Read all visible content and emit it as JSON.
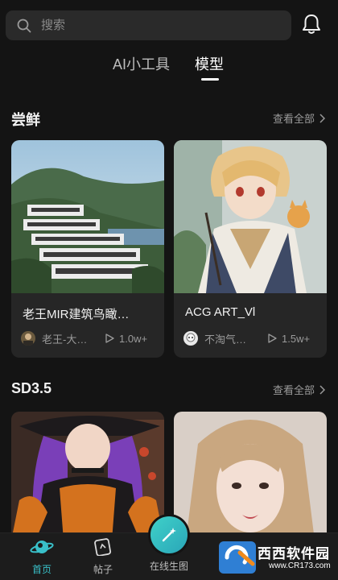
{
  "search": {
    "placeholder": "搜索"
  },
  "tabs": [
    {
      "label": "AI小工具"
    },
    {
      "label": "模型",
      "active": true
    }
  ],
  "sections": [
    {
      "title": "尝鲜",
      "more_label": "查看全部",
      "cards": [
        {
          "title": "老王MIR建筑鸟瞰…",
          "author": "老王-大…",
          "plays": "1.0w+"
        },
        {
          "title": "ACG ART_Vl",
          "author": "不淘气…",
          "plays": "1.5w+"
        }
      ]
    },
    {
      "title": "SD3.5",
      "more_label": "查看全部",
      "cards": []
    }
  ],
  "bottom_nav": [
    {
      "label": "首页",
      "icon": "planet-icon",
      "active": true
    },
    {
      "label": "帖子",
      "icon": "cards-icon"
    },
    {
      "label": "在线生图",
      "icon": "magic-wand-icon"
    }
  ],
  "watermark": {
    "text": "西西软件园",
    "url": "www.CR173.com"
  },
  "colors": {
    "accent": "#39c0c9",
    "background": "#141414",
    "card": "#262626"
  }
}
